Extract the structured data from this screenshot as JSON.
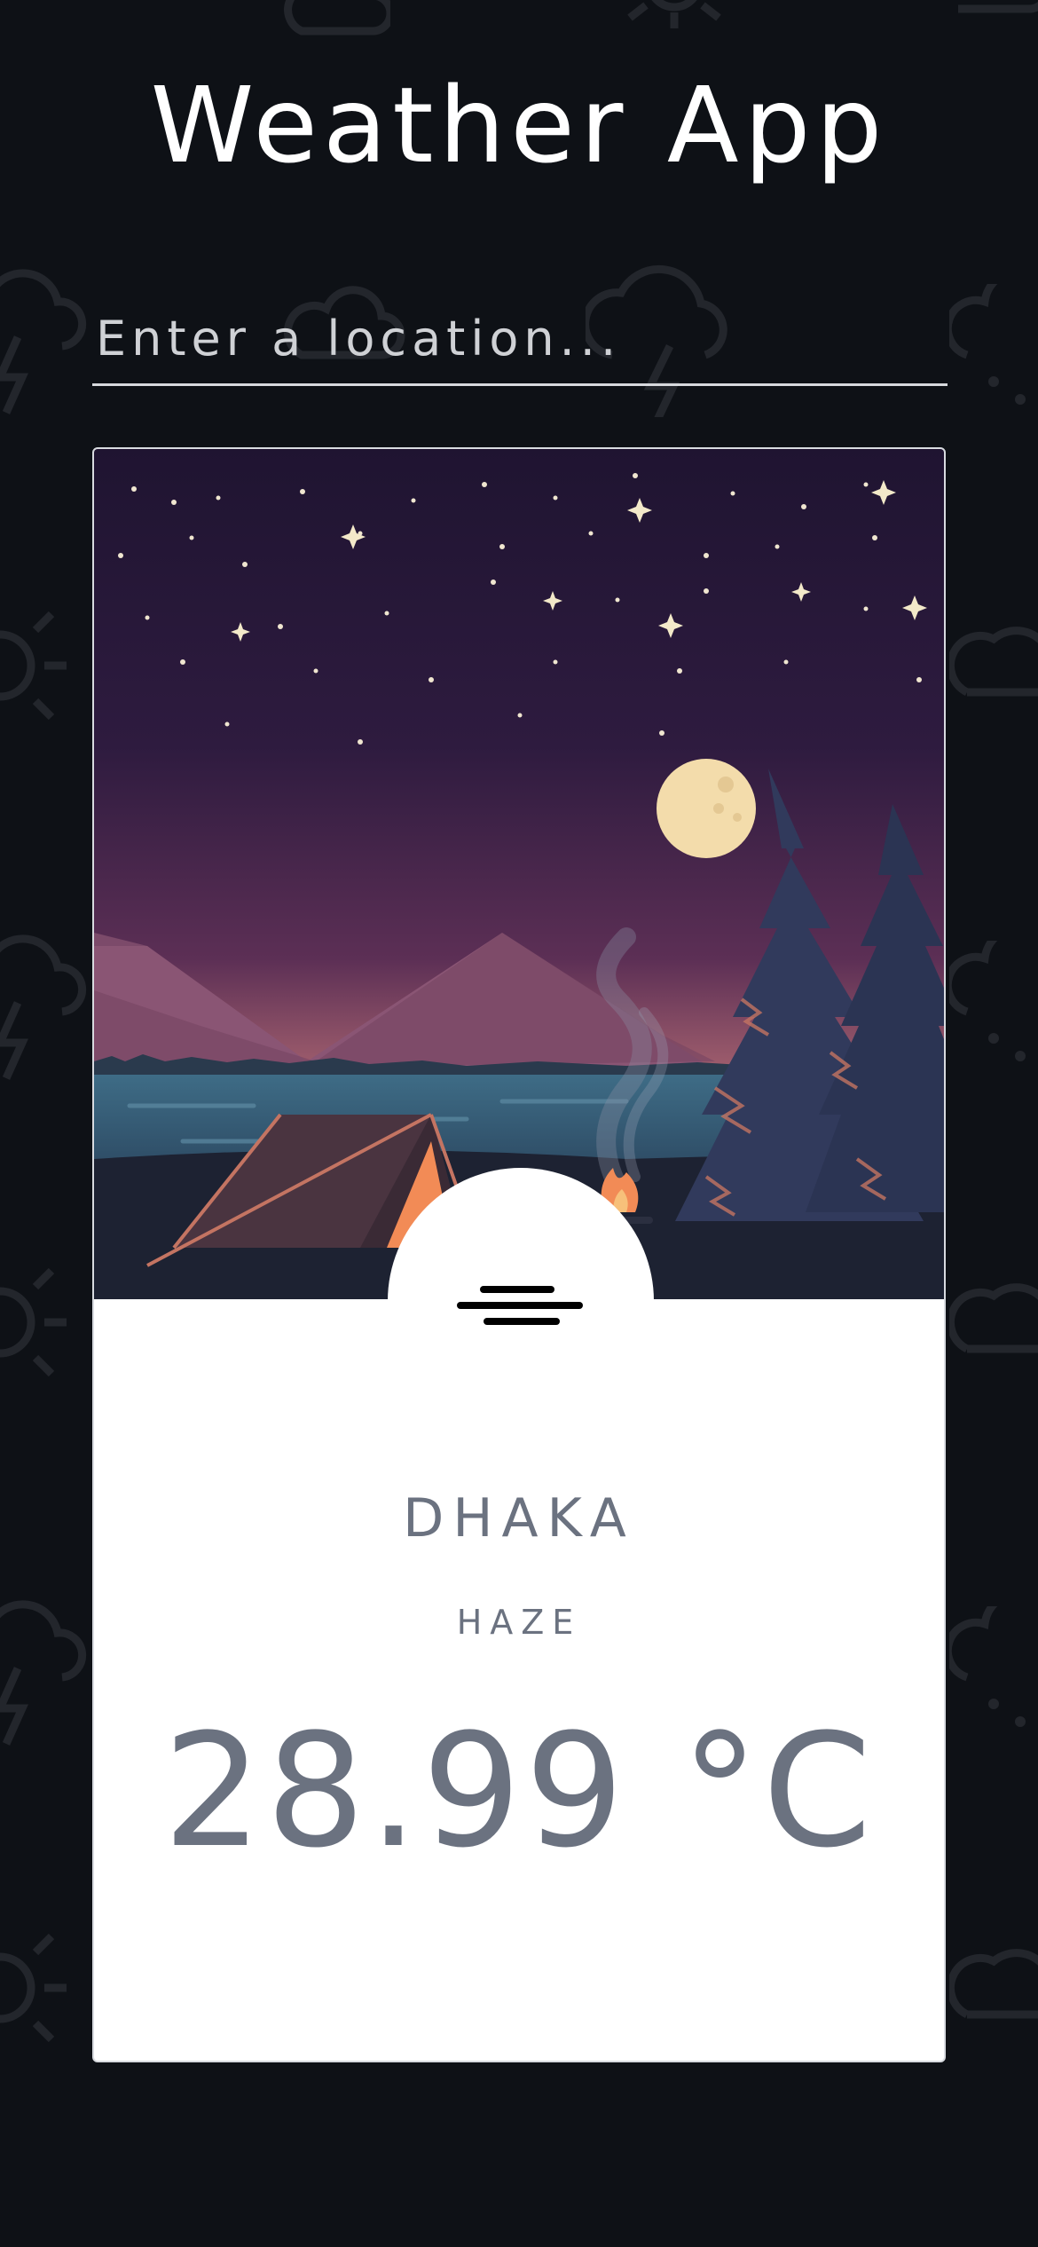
{
  "app": {
    "title": "Weather App"
  },
  "search": {
    "placeholder": "Enter a location..."
  },
  "weather": {
    "city": "DHAKA",
    "condition": "HAZE",
    "temperature": "28.99 °C",
    "condition_icon": "haze-icon"
  },
  "colors": {
    "background": "#0e1116",
    "card": "#ffffff",
    "text_muted": "#6b7280"
  }
}
